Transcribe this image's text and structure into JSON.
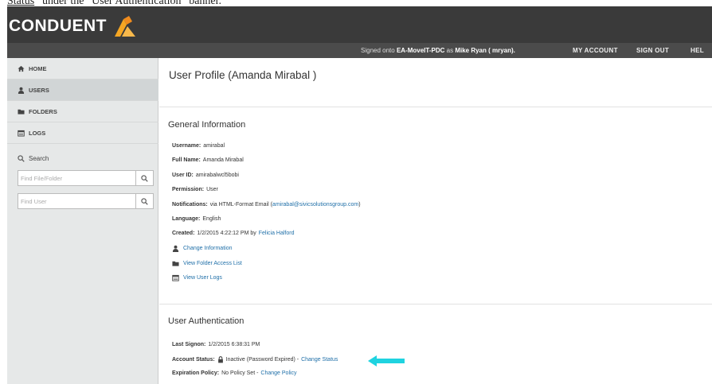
{
  "caption": {
    "before": "Status",
    "after": "” under the “User Authentication” banner."
  },
  "header": {
    "logo_text": "CONDUENT",
    "signed_prefix": "Signed onto",
    "signed_host": "EA-MoveIT-PDC",
    "signed_mid": "as",
    "signed_user": "Mike Ryan ( mryan).",
    "nav": [
      "MY ACCOUNT",
      "SIGN OUT",
      "HEL"
    ]
  },
  "sidebar": {
    "items": [
      {
        "label": "HOME",
        "icon": "home-icon"
      },
      {
        "label": "USERS",
        "icon": "user-icon"
      },
      {
        "label": "FOLDERS",
        "icon": "folder-icon"
      },
      {
        "label": "LOGS",
        "icon": "calendar-icon"
      }
    ],
    "search_label": "Search",
    "find_file_placeholder": "Find File/Folder",
    "find_user_placeholder": "Find User"
  },
  "main": {
    "title": "User Profile (Amanda Mirabal )",
    "general_title": "General Information",
    "username_label": "Username:",
    "username": "amirabal",
    "fullname_label": "Full Name:",
    "fullname": "Amanda Mirabal",
    "userid_label": "User ID:",
    "userid": "amirabalwcl5bobi",
    "permission_label": "Permission:",
    "permission": "User",
    "notifications_label": "Notifications:",
    "notifications_pre": "via HTML-Format Email (",
    "notifications_email": "amirabal@sivicsolutionsgroup.com",
    "notifications_post": ")",
    "language_label": "Language:",
    "language": "English",
    "created_label": "Created:",
    "created": "1/2/2015 4:22:12 PM by",
    "created_by": "Felicia Halford",
    "link_change_info": "Change Information",
    "link_folder_access": "View Folder Access List",
    "link_user_logs": "View User Logs",
    "auth_title": "User Authentication",
    "last_signon_label": "Last Signon:",
    "last_signon": "1/2/2015 6:38:31 PM",
    "account_status_label": "Account Status:",
    "account_status": "Inactive (Password Expired) -",
    "change_status": "Change Status",
    "expiration_label": "Expiration Policy:",
    "expiration": "No Policy Set -",
    "change_policy": "Change Policy"
  },
  "colors": {
    "topbar": "#3a3a3a",
    "navbar": "#4b4b4b",
    "link": "#1f6fa8",
    "arrow": "#1fd3e0",
    "logo_orange": "#f5a623"
  }
}
